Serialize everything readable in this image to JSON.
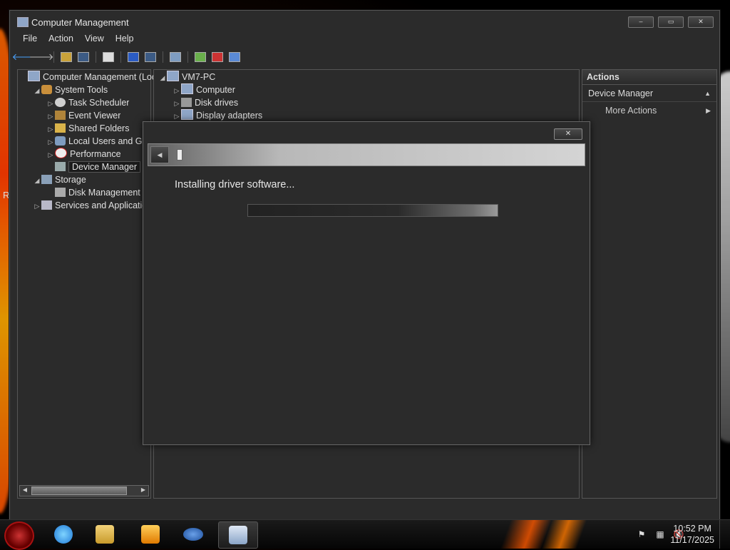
{
  "window": {
    "title": "Computer Management",
    "minimize_label": "‒",
    "maximize_label": "▭",
    "close_label": "✕"
  },
  "menu": [
    "File",
    "Action",
    "View",
    "Help"
  ],
  "left_tree": [
    {
      "label": "Computer Management (Loc",
      "icon": "computer-management-icon",
      "arrow": "",
      "indent": 0
    },
    {
      "label": "System Tools",
      "icon": "system-tools-icon",
      "arrow": "◢",
      "indent": 1
    },
    {
      "label": "Task Scheduler",
      "icon": "task-scheduler-icon",
      "arrow": "▷",
      "indent": 2
    },
    {
      "label": "Event Viewer",
      "icon": "event-viewer-icon",
      "arrow": "▷",
      "indent": 2
    },
    {
      "label": "Shared Folders",
      "icon": "shared-folders-icon",
      "arrow": "▷",
      "indent": 2
    },
    {
      "label": "Local Users and Gro",
      "icon": "local-users-icon",
      "arrow": "▷",
      "indent": 2
    },
    {
      "label": "Performance",
      "icon": "performance-icon",
      "arrow": "▷",
      "indent": 2
    },
    {
      "label": "Device Manager",
      "icon": "device-manager-icon",
      "arrow": "",
      "indent": 2,
      "selected": true
    },
    {
      "label": "Storage",
      "icon": "storage-icon",
      "arrow": "◢",
      "indent": 1
    },
    {
      "label": "Disk Management",
      "icon": "disk-management-icon",
      "arrow": "",
      "indent": 2
    },
    {
      "label": "Services and Applicatio",
      "icon": "services-icon",
      "arrow": "▷",
      "indent": 1
    }
  ],
  "center_tree": {
    "root": "VM7-PC",
    "items": [
      "Computer",
      "Disk drives",
      "Display adapters"
    ]
  },
  "actions": {
    "title": "Actions",
    "section": "Device Manager",
    "more": "More Actions"
  },
  "dialog": {
    "close_label": "✕",
    "message": "Installing driver software...",
    "progress": 1.0
  },
  "taskbar": {
    "time": "10:52 PM",
    "date": "11/17/2025",
    "apps": [
      "internet-explorer-icon",
      "file-explorer-icon",
      "media-player-icon",
      "network-app-icon",
      "computer-management-icon"
    ]
  },
  "desktop": {
    "edge_text": "R"
  },
  "colors": {
    "window_bg": "#2b2b2b",
    "accent_flame": "#ff5a00"
  }
}
